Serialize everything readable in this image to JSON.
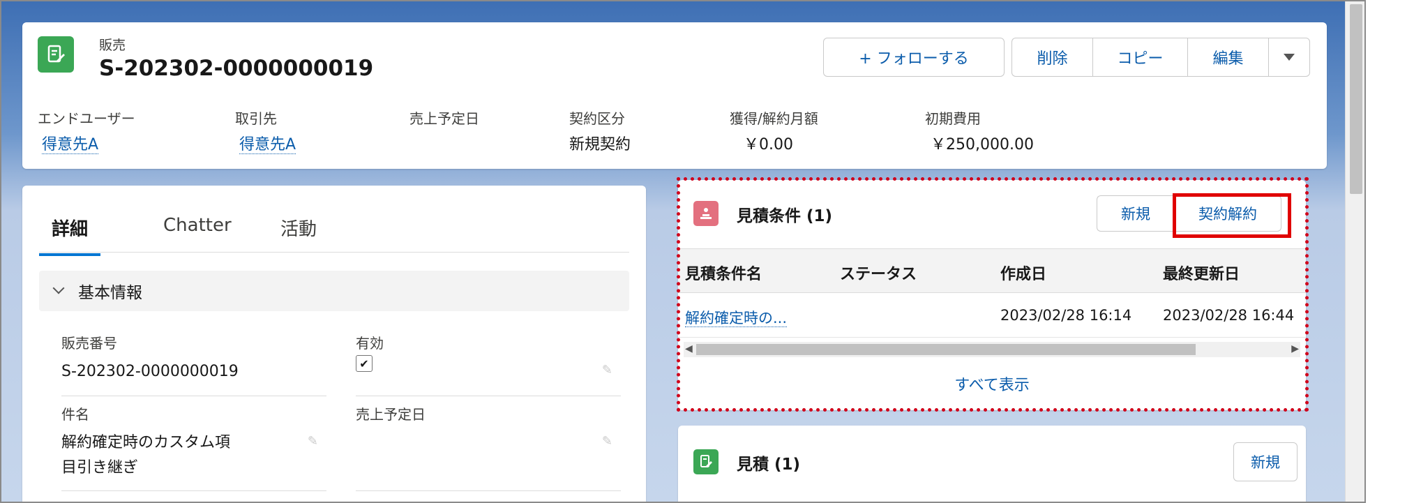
{
  "header": {
    "object_label": "販売",
    "record_title": "S-202302-0000000019",
    "follow_button": "+ フォローする",
    "actions": [
      "削除",
      "コピー",
      "編集"
    ],
    "dropdown_icon": "chevron-down-icon",
    "highlights": [
      {
        "label": "エンドユーザー",
        "value": "得意先A",
        "link": true
      },
      {
        "label": "取引先",
        "value": "得意先A",
        "link": true
      },
      {
        "label": "売上予定日",
        "value": "",
        "link": false
      },
      {
        "label": "契約区分",
        "value": "新規契約",
        "link": false
      },
      {
        "label": "獲得/解約月額",
        "value": "￥0.00",
        "link": false
      },
      {
        "label": "初期費用",
        "value": "￥250,000.00",
        "link": false
      }
    ]
  },
  "detail": {
    "tabs": [
      "詳細",
      "Chatter",
      "活動"
    ],
    "section_title": "基本情報",
    "fields": {
      "sales_number_label": "販売番号",
      "sales_number_value": "S-202302-0000000019",
      "valid_label": "有効",
      "subject_label": "件名",
      "subject_value_line1": "解約確定時のカスタム項",
      "subject_value_line2": "目引き継ぎ",
      "sales_date_label": "売上予定日"
    }
  },
  "quote_conditions": {
    "title": "見積条件 (1)",
    "new_button": "新規",
    "cancel_button": "契約解約",
    "columns": [
      "見積条件名",
      "ステータス",
      "作成日",
      "最終更新日"
    ],
    "rows": [
      {
        "name": "解約確定時の...",
        "status": "",
        "created": "2023/02/28 16:14",
        "updated": "2023/02/28 16:44"
      }
    ],
    "view_all": "すべて表示"
  },
  "quotes": {
    "title": "見積 (1)",
    "new_button": "新規"
  },
  "colors": {
    "brand_blue": "#0b5cab",
    "active_tab": "#0176d3",
    "sales_icon_green": "#3ba755",
    "quote_condition_icon": "#e3707f",
    "highlight_red": "#e00000"
  }
}
